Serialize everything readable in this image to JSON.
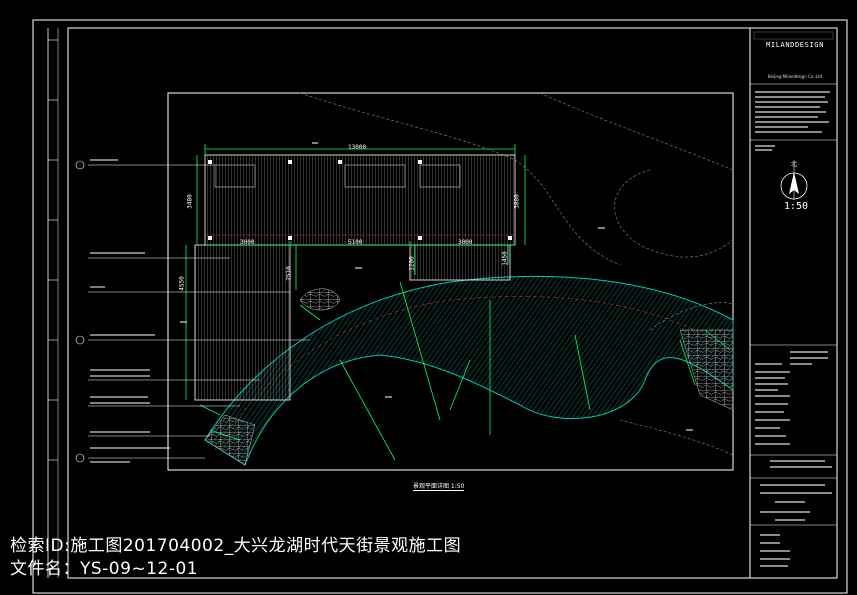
{
  "caption": {
    "line1": "检索ID:施工图201704002_大兴龙湖时代天街景观施工图",
    "line2": "文件名：YS-09~12-01"
  },
  "title_block": {
    "brand": "MILANDDESIGN",
    "sub": "Beijing Milandesign Co.,Ltd"
  },
  "drawing": {
    "scale": "1:50",
    "title": "景观平面详图 1:50",
    "dims": {
      "top_width": "13000",
      "seg_left": "3000",
      "seg_mid": "5100",
      "seg_right": "3000",
      "left_vert": "3480",
      "right_vert": "3880",
      "small_a": "2510",
      "small_b": "1200",
      "small_c": "1450",
      "left_tall": "4550"
    }
  },
  "colors": {
    "bg": "#000000",
    "line": "#ffffff",
    "dim": "#00ff66",
    "hatch": "#00c8b4",
    "accent": "#ff3030"
  }
}
